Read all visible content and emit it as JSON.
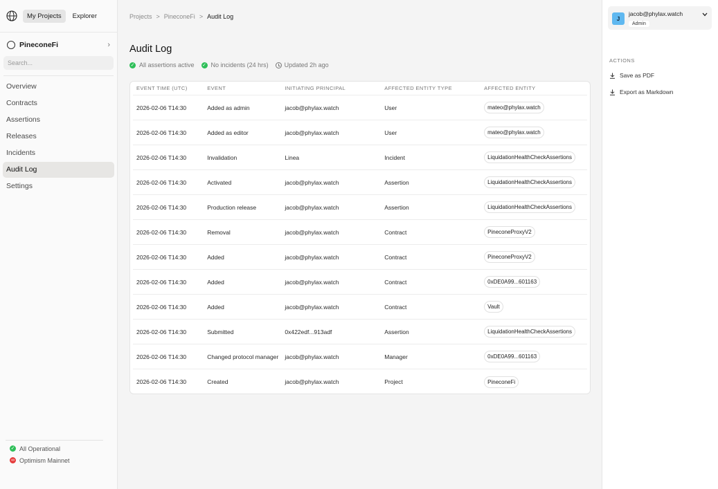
{
  "topnav": {
    "my_projects": "My Projects",
    "explorer": "Explorer"
  },
  "project": {
    "name": "PineconeFi"
  },
  "search": {
    "placeholder": "Search..."
  },
  "sidebar": {
    "items": [
      {
        "label": "Overview"
      },
      {
        "label": "Contracts"
      },
      {
        "label": "Assertions"
      },
      {
        "label": "Releases"
      },
      {
        "label": "Incidents"
      },
      {
        "label": "Audit Log"
      },
      {
        "label": "Settings"
      }
    ],
    "active_index": 5
  },
  "status": {
    "operational": "All Operational",
    "network": "Optimism Mainnet"
  },
  "breadcrumb": {
    "root": "Projects",
    "project": "PineconeFi",
    "current": "Audit Log",
    "separator": ">"
  },
  "page": {
    "title": "Audit Log",
    "assertions_status": "All assertions active",
    "incidents_status": "No incidents (24 hrs)",
    "updated": "Updated 2h ago"
  },
  "table": {
    "headers": [
      "EVENT TIME (UTC)",
      "EVENT",
      "INITIATING PRINCIPAL",
      "AFFECTED ENTITY TYPE",
      "AFFECTED ENTITY"
    ],
    "rows": [
      [
        "2026-02-06 T14:30",
        "Added as admin",
        "jacob@phylax.watch",
        "User",
        "mateo@phylax.watch"
      ],
      [
        "2026-02-06 T14:30",
        "Added as editor",
        "jacob@phylax.watch",
        "User",
        "mateo@phylax.watch"
      ],
      [
        "2026-02-06 T14:30",
        "Invalidation",
        "Linea",
        "Incident",
        "LiquidationHealthCheckAssertions"
      ],
      [
        "2026-02-06 T14:30",
        "Activated",
        "jacob@phylax.watch",
        "Assertion",
        "LiquidationHealthCheckAssertions"
      ],
      [
        "2026-02-06 T14:30",
        "Production release",
        "jacob@phylax.watch",
        "Assertion",
        "LiquidationHealthCheckAssertions"
      ],
      [
        "2026-02-06 T14:30",
        "Removal",
        "jacob@phylax.watch",
        "Contract",
        "PineconeProxyV2"
      ],
      [
        "2026-02-06 T14:30",
        "Added",
        "jacob@phylax.watch",
        "Contract",
        "PineconeProxyV2"
      ],
      [
        "2026-02-06 T14:30",
        "Added",
        "jacob@phylax.watch",
        "Contract",
        "0xDE0A99...601163"
      ],
      [
        "2026-02-06 T14:30",
        "Added",
        "jacob@phylax.watch",
        "Contract",
        "Vault"
      ],
      [
        "2026-02-06 T14:30",
        "Submitted",
        "0x422edf...913adf",
        "Assertion",
        "LiquidationHealthCheckAssertions"
      ],
      [
        "2026-02-06 T14:30",
        "Changed protocol manager",
        "jacob@phylax.watch",
        "Manager",
        "0xDE0A99...601163"
      ],
      [
        "2026-02-06 T14:30",
        "Created",
        "jacob@phylax.watch",
        "Project",
        "PineconeFi"
      ]
    ]
  },
  "user": {
    "initial": "J",
    "email": "jacob@phylax.watch",
    "role": "Admin"
  },
  "actions": {
    "heading": "ACTIONS",
    "save_pdf": "Save as PDF",
    "export_md": "Export as Markdown"
  },
  "colors": {
    "success": "#2fbf59",
    "error": "#e53a3a",
    "avatar": "#5fb8f0",
    "active_nav": "#e7e6e4"
  }
}
